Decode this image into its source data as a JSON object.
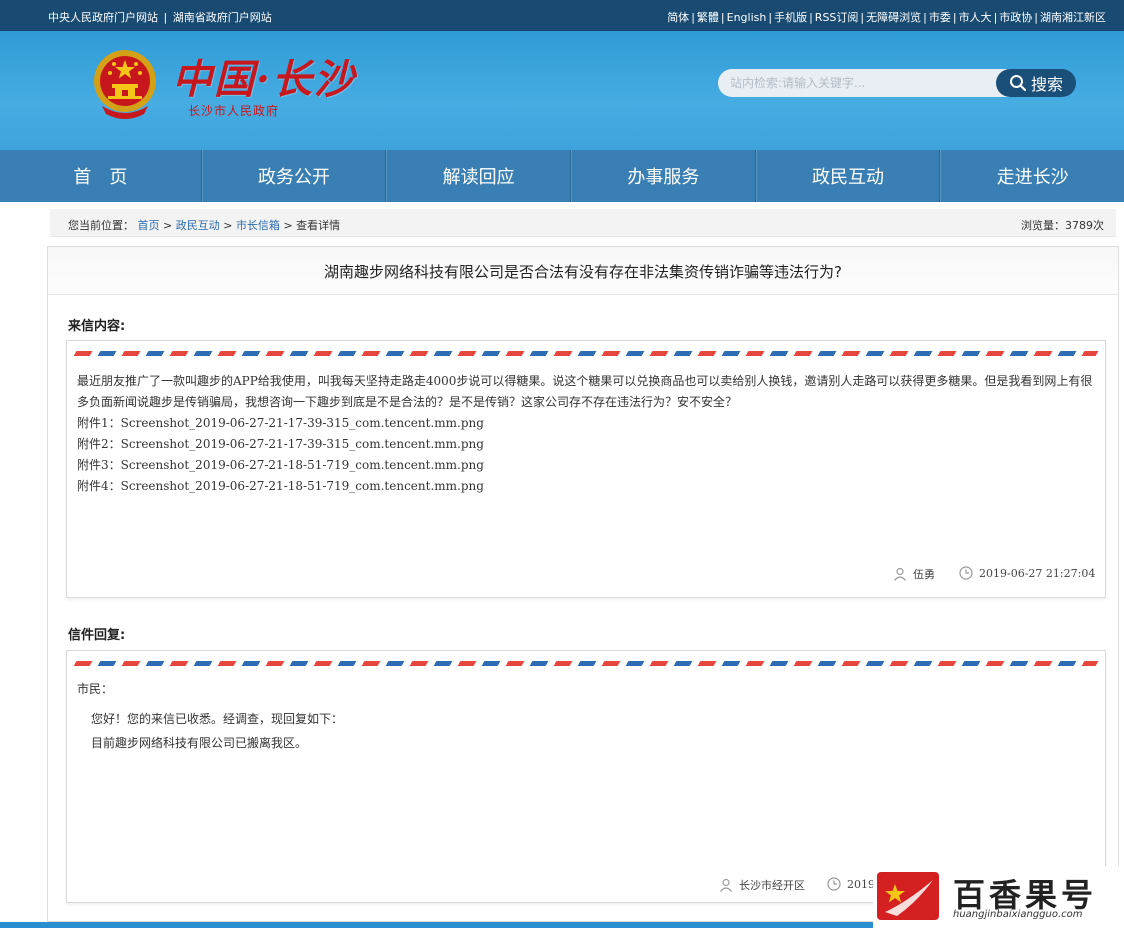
{
  "topbar": {
    "left_links": [
      "中央人民政府门户网站",
      "湖南省政府门户网站"
    ],
    "right_links": [
      "简体",
      "繁體",
      "English",
      "手机版",
      "RSS订阅",
      "无障碍浏览",
      "市委",
      "市人大",
      "市政协",
      "湖南湘江新区"
    ]
  },
  "header": {
    "logo_title": "中国·长沙",
    "logo_subtitle": "长沙市人民政府",
    "search_placeholder": "站内检索:请输入关键字...",
    "search_button": "搜索"
  },
  "nav": [
    "首页",
    "政务公开",
    "解读回应",
    "办事服务",
    "政民互动",
    "走进长沙"
  ],
  "breadcrumb": {
    "prefix": "您当前位置：",
    "items": [
      "首页",
      "政民互动",
      "市长信箱",
      "查看详情"
    ],
    "views_label": "浏览量：",
    "views": "3789次"
  },
  "article": {
    "title": "湖南趣步网络科技有限公司是否合法有没有存在非法集资传销诈骗等违法行为?",
    "letter_label": "来信内容:",
    "letter_paragraph": "最近朋友推广了一款叫趣步的APP给我使用，叫我每天坚持走路走4000步说可以得糖果。说这个糖果可以兑换商品也可以卖给别人换钱，邀请别人走路可以获得更多糖果。但是我看到网上有很多负面新闻说趣步是传销骗局，我想咨询一下趣步到底是不是合法的？是不是传销？这家公司存不存在违法行为？安不安全？",
    "attachments": [
      "附件1：Screenshot_2019-06-27-21-17-39-315_com.tencent.mm.png",
      "附件2：Screenshot_2019-06-27-21-17-39-315_com.tencent.mm.png",
      "附件3：Screenshot_2019-06-27-21-18-51-719_com.tencent.mm.png",
      "附件4：Screenshot_2019-06-27-21-18-51-719_com.tencent.mm.png"
    ],
    "letter_author": "伍勇",
    "letter_time": "2019-06-27 21:27:04",
    "reply_label": "信件回复:",
    "reply_greeting": "市民：",
    "reply_lines": [
      "您好！您的来信已收悉。经调查，现回复如下：",
      "目前趣步网络科技有限公司已搬离我区。"
    ],
    "reply_author": "长沙市经开区",
    "reply_time": "2019-"
  },
  "watermark": {
    "name": "百香果号",
    "url": "huangjinbaixiangguo.com"
  },
  "colors": {
    "topbar": "#184a72",
    "nav": "#3a7fb3",
    "header": "#3ea3dc",
    "logo_red": "#c8161d",
    "link": "#2b6cb0"
  }
}
